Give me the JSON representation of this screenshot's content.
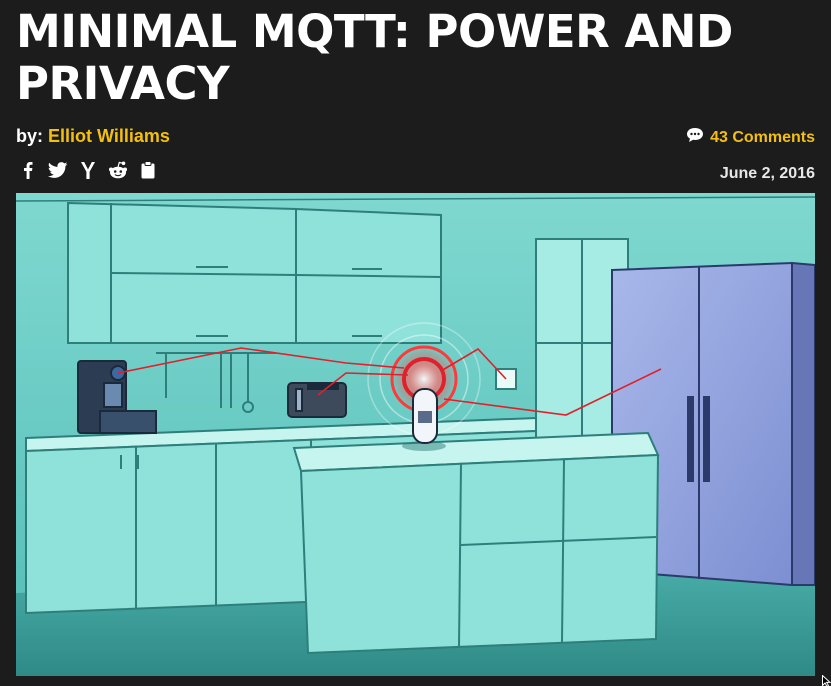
{
  "article": {
    "title": "MINIMAL MQTT: POWER AND PRIVACY",
    "by_prefix": "by: ",
    "author": "Elliot Williams",
    "comments": "43 Comments",
    "date": "June 2, 2016"
  },
  "share_icons": [
    "facebook-icon",
    "twitter-icon",
    "hackernews-icon",
    "reddit-icon",
    "clipboard-icon"
  ],
  "colors": {
    "background": "#1c1c1c",
    "accent": "#f3bf10",
    "text": "#ffffff",
    "kitchen_teal": "#5fc6c0",
    "signal_red": "#e0202a"
  }
}
